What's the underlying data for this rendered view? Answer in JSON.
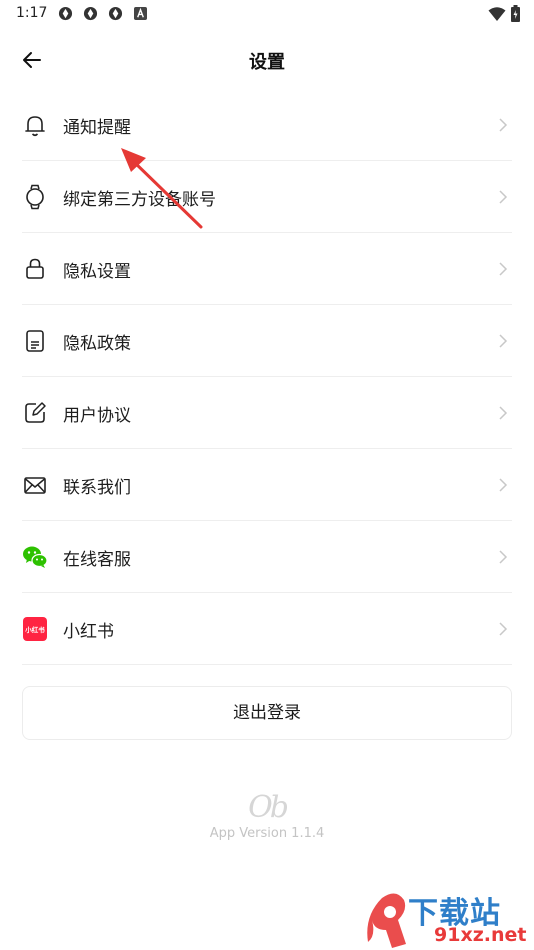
{
  "status_bar": {
    "time": "1:17"
  },
  "header": {
    "title": "设置"
  },
  "menu": [
    {
      "label": "通知提醒",
      "icon": "bell-icon"
    },
    {
      "label": "绑定第三方设备账号",
      "icon": "watch-icon"
    },
    {
      "label": "隐私设置",
      "icon": "lock-icon"
    },
    {
      "label": "隐私政策",
      "icon": "document-icon"
    },
    {
      "label": "用户协议",
      "icon": "edit-icon"
    },
    {
      "label": "联系我们",
      "icon": "mail-icon"
    },
    {
      "label": "在线客服",
      "icon": "wechat-icon"
    },
    {
      "label": "小红书",
      "icon": "xiaohongshu-icon",
      "badge_text": "小红书"
    }
  ],
  "logout_label": "退出登录",
  "footer": {
    "logo": "Ob",
    "version": "App Version 1.1.4"
  },
  "watermark": {
    "brand": "下载站",
    "domain": "91xz.net"
  },
  "colors": {
    "accent_red": "#e53935",
    "wechat_green": "#2dc100",
    "xiaohongshu_red": "#ff2442",
    "divider": "#eeeeee"
  }
}
